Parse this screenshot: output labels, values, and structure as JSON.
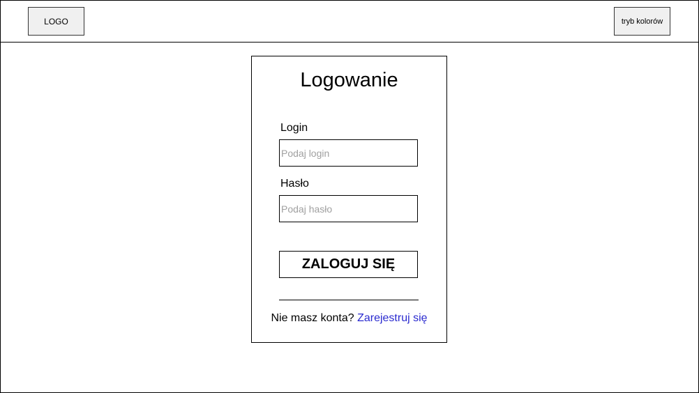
{
  "header": {
    "logo_text": "LOGO",
    "color_mode_label": "tryb kolorów"
  },
  "login": {
    "title": "Logowanie",
    "login_label": "Login",
    "login_placeholder": "Podaj login",
    "password_label": "Hasło",
    "password_placeholder": "Podaj hasło",
    "submit_label": "ZALOGUJ SIĘ",
    "no_account_text": "Nie masz konta?",
    "register_link": "Zarejestruj się"
  },
  "colors": {
    "link": "#2a2acf",
    "placeholder": "#a0a0a0",
    "box_fill": "#f0f0f0"
  }
}
